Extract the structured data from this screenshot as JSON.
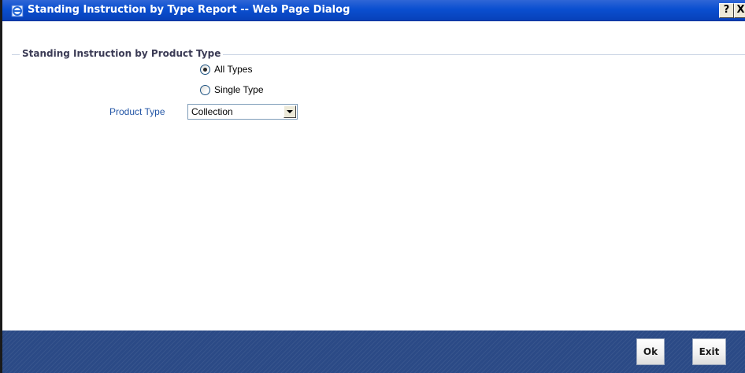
{
  "window": {
    "title": "Standing Instruction by Type Report -- Web Page Dialog",
    "help_label": "?",
    "close_label": "X"
  },
  "section": {
    "legend": "Standing Instruction by Product Type"
  },
  "radio_group": {
    "options": [
      {
        "label": "All Types",
        "checked": true
      },
      {
        "label": "Single Type",
        "checked": false
      }
    ]
  },
  "product_type": {
    "label": "Product Type",
    "value": "Collection"
  },
  "footer": {
    "ok_label": "Ok",
    "exit_label": "Exit"
  },
  "colors": {
    "titlebar": "#0a4fd0",
    "footer": "#2b4a86",
    "field_label": "#2356a6"
  },
  "icons": {
    "title": "ie-page-icon",
    "dropdown": "chevron-down-icon"
  }
}
